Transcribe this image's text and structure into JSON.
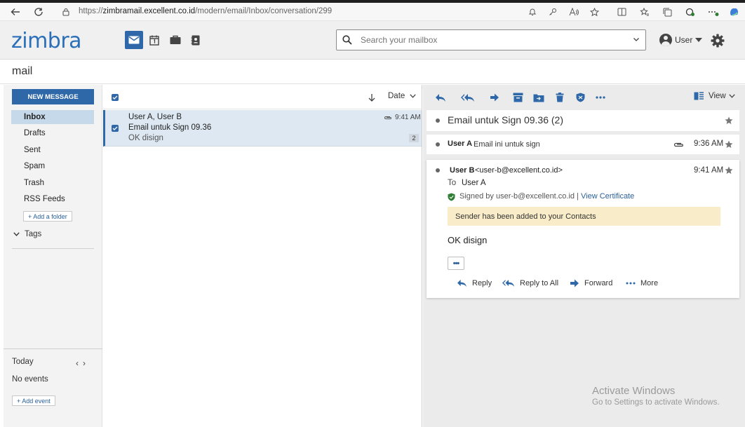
{
  "browser": {
    "url_prefix": "https://",
    "url_host": "zimbramail.excellent.co.id",
    "url_path": "/modern/email/Inbox/conversation/299"
  },
  "header": {
    "logo": "zimbra",
    "search_placeholder": "Search your mailbox",
    "user_label": "User"
  },
  "page_title": "mail",
  "sidebar": {
    "new_message": "NEW MESSAGE",
    "folders": [
      "Inbox",
      "Drafts",
      "Sent",
      "Spam",
      "Trash",
      "RSS Feeds"
    ],
    "add_folder": "+ Add a folder",
    "tags": "Tags",
    "today": "Today",
    "no_events": "No events",
    "add_event": "+ Add event"
  },
  "list": {
    "sort_label": "Date",
    "messages": [
      {
        "from": "User A, User B",
        "subject": "Email untuk Sign 09.36",
        "preview": "OK disign",
        "time": "9:41 AM",
        "count": "2"
      }
    ]
  },
  "reader": {
    "view_label": "View",
    "conversation_title": "Email untuk Sign 09.36 (2)",
    "collapsed": {
      "sender": "User A",
      "snippet": "Email ini untuk sign",
      "time": "9:36 AM"
    },
    "expanded": {
      "sender": "User B",
      "address": "<user-b@excellent.co.id>",
      "time": "9:41 AM",
      "to_label": "To",
      "to_value": "User A",
      "signed_text": "Signed by user-b@excellent.co.id |",
      "view_cert": "View Certificate",
      "notice": "Sender has been added to your Contacts",
      "body": "OK disign",
      "actions": [
        "Reply",
        "Reply to All",
        "Forward",
        "More"
      ]
    }
  },
  "watermark": {
    "line1": "Activate Windows",
    "line2": "Go to Settings to activate Windows."
  },
  "colors": {
    "accent": "#2f68a8",
    "logo": "#2a6fb8",
    "notice": "#f9ecc8"
  }
}
